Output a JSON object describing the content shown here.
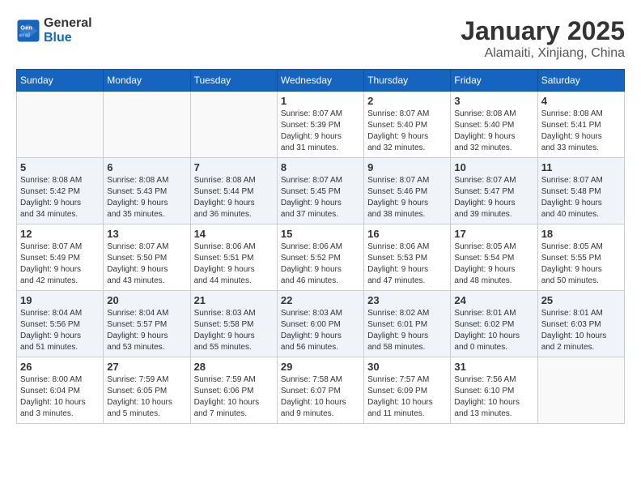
{
  "header": {
    "logo_line1": "General",
    "logo_line2": "Blue",
    "month": "January 2025",
    "location": "Alamaiti, Xinjiang, China"
  },
  "weekdays": [
    "Sunday",
    "Monday",
    "Tuesday",
    "Wednesday",
    "Thursday",
    "Friday",
    "Saturday"
  ],
  "weeks": [
    [
      {
        "day": "",
        "info": ""
      },
      {
        "day": "",
        "info": ""
      },
      {
        "day": "",
        "info": ""
      },
      {
        "day": "1",
        "info": "Sunrise: 8:07 AM\nSunset: 5:39 PM\nDaylight: 9 hours\nand 31 minutes."
      },
      {
        "day": "2",
        "info": "Sunrise: 8:07 AM\nSunset: 5:40 PM\nDaylight: 9 hours\nand 32 minutes."
      },
      {
        "day": "3",
        "info": "Sunrise: 8:08 AM\nSunset: 5:40 PM\nDaylight: 9 hours\nand 32 minutes."
      },
      {
        "day": "4",
        "info": "Sunrise: 8:08 AM\nSunset: 5:41 PM\nDaylight: 9 hours\nand 33 minutes."
      }
    ],
    [
      {
        "day": "5",
        "info": "Sunrise: 8:08 AM\nSunset: 5:42 PM\nDaylight: 9 hours\nand 34 minutes."
      },
      {
        "day": "6",
        "info": "Sunrise: 8:08 AM\nSunset: 5:43 PM\nDaylight: 9 hours\nand 35 minutes."
      },
      {
        "day": "7",
        "info": "Sunrise: 8:08 AM\nSunset: 5:44 PM\nDaylight: 9 hours\nand 36 minutes."
      },
      {
        "day": "8",
        "info": "Sunrise: 8:07 AM\nSunset: 5:45 PM\nDaylight: 9 hours\nand 37 minutes."
      },
      {
        "day": "9",
        "info": "Sunrise: 8:07 AM\nSunset: 5:46 PM\nDaylight: 9 hours\nand 38 minutes."
      },
      {
        "day": "10",
        "info": "Sunrise: 8:07 AM\nSunset: 5:47 PM\nDaylight: 9 hours\nand 39 minutes."
      },
      {
        "day": "11",
        "info": "Sunrise: 8:07 AM\nSunset: 5:48 PM\nDaylight: 9 hours\nand 40 minutes."
      }
    ],
    [
      {
        "day": "12",
        "info": "Sunrise: 8:07 AM\nSunset: 5:49 PM\nDaylight: 9 hours\nand 42 minutes."
      },
      {
        "day": "13",
        "info": "Sunrise: 8:07 AM\nSunset: 5:50 PM\nDaylight: 9 hours\nand 43 minutes."
      },
      {
        "day": "14",
        "info": "Sunrise: 8:06 AM\nSunset: 5:51 PM\nDaylight: 9 hours\nand 44 minutes."
      },
      {
        "day": "15",
        "info": "Sunrise: 8:06 AM\nSunset: 5:52 PM\nDaylight: 9 hours\nand 46 minutes."
      },
      {
        "day": "16",
        "info": "Sunrise: 8:06 AM\nSunset: 5:53 PM\nDaylight: 9 hours\nand 47 minutes."
      },
      {
        "day": "17",
        "info": "Sunrise: 8:05 AM\nSunset: 5:54 PM\nDaylight: 9 hours\nand 48 minutes."
      },
      {
        "day": "18",
        "info": "Sunrise: 8:05 AM\nSunset: 5:55 PM\nDaylight: 9 hours\nand 50 minutes."
      }
    ],
    [
      {
        "day": "19",
        "info": "Sunrise: 8:04 AM\nSunset: 5:56 PM\nDaylight: 9 hours\nand 51 minutes."
      },
      {
        "day": "20",
        "info": "Sunrise: 8:04 AM\nSunset: 5:57 PM\nDaylight: 9 hours\nand 53 minutes."
      },
      {
        "day": "21",
        "info": "Sunrise: 8:03 AM\nSunset: 5:58 PM\nDaylight: 9 hours\nand 55 minutes."
      },
      {
        "day": "22",
        "info": "Sunrise: 8:03 AM\nSunset: 6:00 PM\nDaylight: 9 hours\nand 56 minutes."
      },
      {
        "day": "23",
        "info": "Sunrise: 8:02 AM\nSunset: 6:01 PM\nDaylight: 9 hours\nand 58 minutes."
      },
      {
        "day": "24",
        "info": "Sunrise: 8:01 AM\nSunset: 6:02 PM\nDaylight: 10 hours\nand 0 minutes."
      },
      {
        "day": "25",
        "info": "Sunrise: 8:01 AM\nSunset: 6:03 PM\nDaylight: 10 hours\nand 2 minutes."
      }
    ],
    [
      {
        "day": "26",
        "info": "Sunrise: 8:00 AM\nSunset: 6:04 PM\nDaylight: 10 hours\nand 3 minutes."
      },
      {
        "day": "27",
        "info": "Sunrise: 7:59 AM\nSunset: 6:05 PM\nDaylight: 10 hours\nand 5 minutes."
      },
      {
        "day": "28",
        "info": "Sunrise: 7:59 AM\nSunset: 6:06 PM\nDaylight: 10 hours\nand 7 minutes."
      },
      {
        "day": "29",
        "info": "Sunrise: 7:58 AM\nSunset: 6:07 PM\nDaylight: 10 hours\nand 9 minutes."
      },
      {
        "day": "30",
        "info": "Sunrise: 7:57 AM\nSunset: 6:09 PM\nDaylight: 10 hours\nand 11 minutes."
      },
      {
        "day": "31",
        "info": "Sunrise: 7:56 AM\nSunset: 6:10 PM\nDaylight: 10 hours\nand 13 minutes."
      },
      {
        "day": "",
        "info": ""
      }
    ]
  ]
}
